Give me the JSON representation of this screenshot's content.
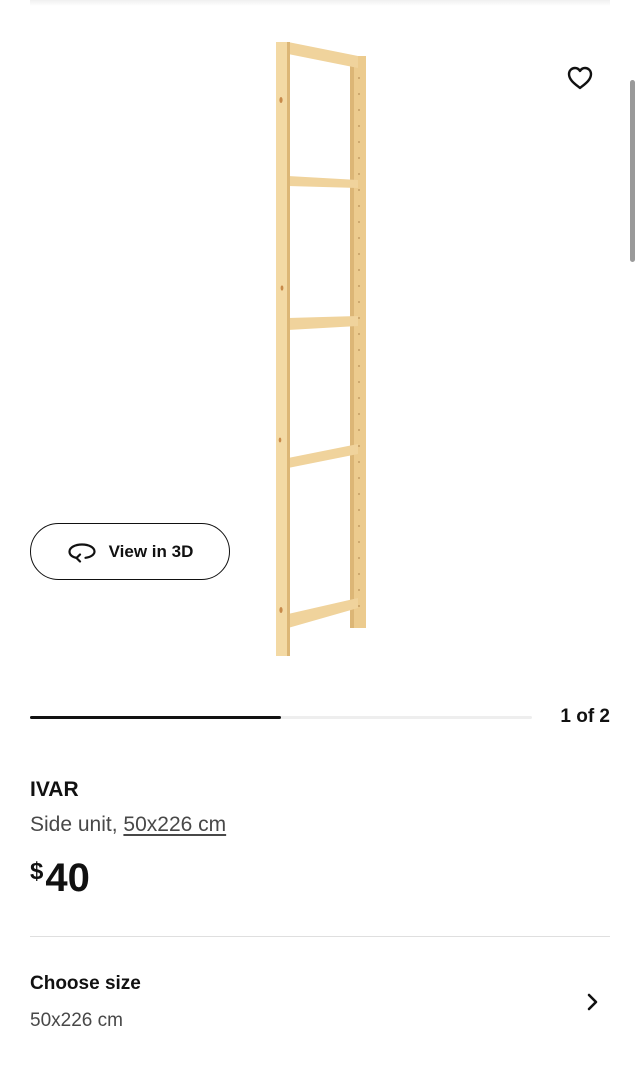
{
  "gallery": {
    "view_in_3d_label": "View in 3D",
    "icons": {
      "favorite": "heart-icon",
      "view_3d": "rotate-3d-icon"
    },
    "counter_text": "1 of 2",
    "current_index": 1,
    "total_images": 2,
    "progress_fraction": 0.5
  },
  "product": {
    "name": "IVAR",
    "description_prefix": "Side unit, ",
    "description_measure": "50x226 cm",
    "price_currency": "$",
    "price_amount": "40"
  },
  "size_selector": {
    "title": "Choose size",
    "value": "50x226 cm",
    "icon": "chevron-right-icon"
  },
  "colors": {
    "text": "#111111",
    "secondary_text": "#484848",
    "wood_light": "#f1d9a3",
    "wood_dark": "#dfb877"
  }
}
